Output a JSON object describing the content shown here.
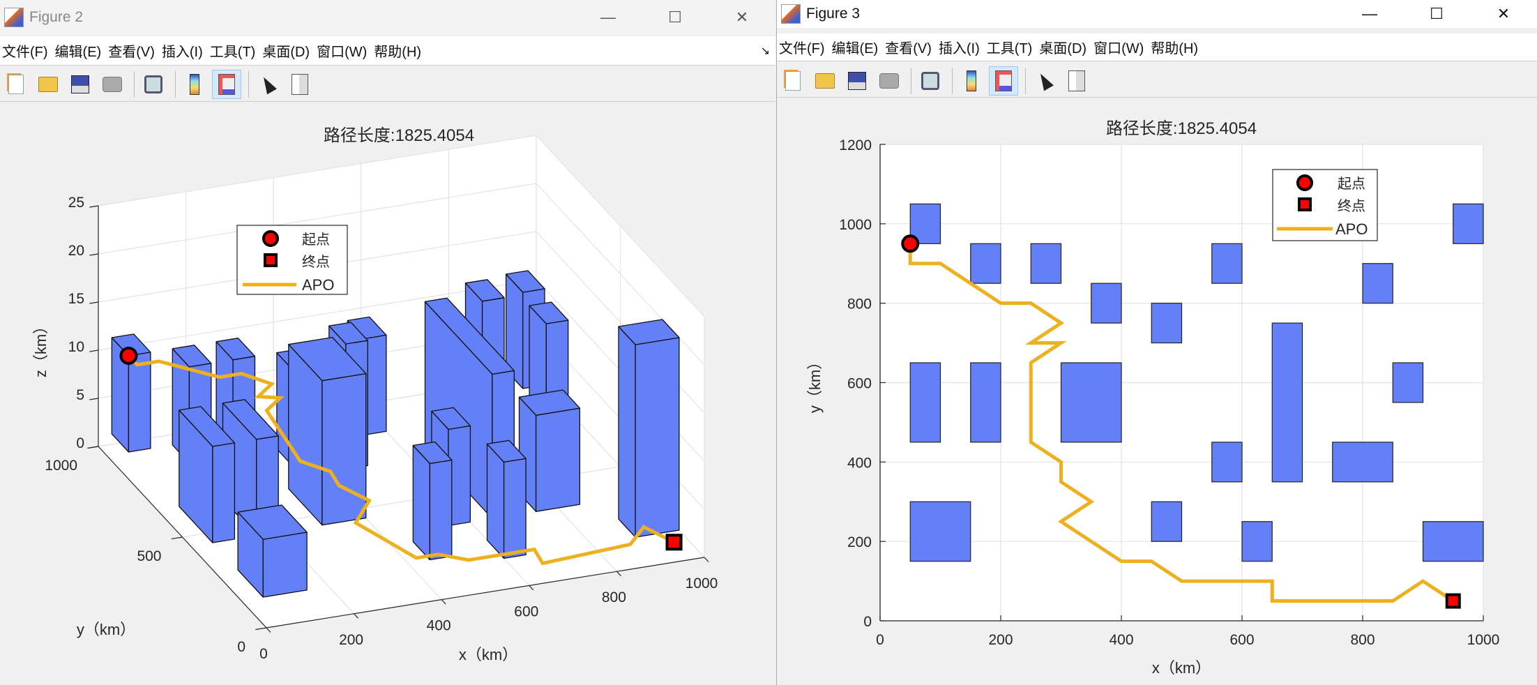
{
  "windows": [
    {
      "title": "Figure 2",
      "controls": {
        "minimize": "—",
        "maximize": "☐",
        "close": "✕"
      }
    },
    {
      "title": "Figure 3",
      "controls": {
        "minimize": "—",
        "maximize": "☐",
        "close": "✕"
      }
    }
  ],
  "menu": [
    "文件(F)",
    "编辑(E)",
    "查看(V)",
    "插入(I)",
    "工具(T)",
    "桌面(D)",
    "窗口(W)",
    "帮助(H)"
  ],
  "dock_icon": "↘",
  "toolbar": [
    "new-figure-icon",
    "open-icon",
    "save-icon",
    "print-icon",
    "link-plot-icon",
    "colorbar-icon",
    "legend-icon",
    "pointer-icon",
    "property-inspector-icon"
  ],
  "colors": {
    "obstacle": "#6480f6",
    "path": "#edb120",
    "marker": "#ff0000",
    "grid": "#e3e3e3"
  },
  "chart_data": [
    {
      "type": "3d-bar-scene",
      "title": "路径长度:1825.4054",
      "xlabel": "x（km）",
      "ylabel": "y（km）",
      "zlabel": "z（km）",
      "xlim": [
        0,
        1000
      ],
      "ylim": [
        0,
        1000
      ],
      "zlim": [
        0,
        25
      ],
      "xticks": [
        0,
        200,
        400,
        600,
        800,
        1000
      ],
      "yticks": [
        0,
        500,
        1000
      ],
      "zticks": [
        0,
        5,
        10,
        15,
        20,
        25
      ],
      "grid": true,
      "legend": {
        "position": "top-left",
        "entries": [
          "起点",
          "终点",
          "APO"
        ]
      },
      "obstacles": [
        {
          "x": [
            50,
            100
          ],
          "y": [
            950,
            1050
          ],
          "h": 10
        },
        {
          "x": [
            150,
            200
          ],
          "y": [
            850,
            950
          ],
          "h": 10
        },
        {
          "x": [
            250,
            300
          ],
          "y": [
            850,
            950
          ],
          "h": 10
        },
        {
          "x": [
            350,
            400
          ],
          "y": [
            750,
            850
          ],
          "h": 10
        },
        {
          "x": [
            450,
            500
          ],
          "y": [
            700,
            800
          ],
          "h": 13
        },
        {
          "x": [
            550,
            600
          ],
          "y": [
            850,
            950
          ],
          "h": 10
        },
        {
          "x": [
            800,
            850
          ],
          "y": [
            800,
            900
          ],
          "h": 13
        },
        {
          "x": [
            950,
            1000
          ],
          "y": [
            950,
            1050
          ],
          "h": 10
        },
        {
          "x": [
            50,
            100
          ],
          "y": [
            450,
            650
          ],
          "h": 10
        },
        {
          "x": [
            150,
            200
          ],
          "y": [
            450,
            650
          ],
          "h": 10
        },
        {
          "x": [
            300,
            400
          ],
          "y": [
            450,
            650
          ],
          "h": 15
        },
        {
          "x": [
            650,
            700
          ],
          "y": [
            350,
            750
          ],
          "h": 15
        },
        {
          "x": [
            850,
            900
          ],
          "y": [
            550,
            650
          ],
          "h": 15
        },
        {
          "x": [
            550,
            600
          ],
          "y": [
            350,
            450
          ],
          "h": 10
        },
        {
          "x": [
            750,
            850
          ],
          "y": [
            350,
            450
          ],
          "h": 10
        },
        {
          "x": [
            50,
            150
          ],
          "y": [
            150,
            300
          ],
          "h": 6
        },
        {
          "x": [
            450,
            500
          ],
          "y": [
            200,
            300
          ],
          "h": 10
        },
        {
          "x": [
            600,
            650
          ],
          "y": [
            150,
            250
          ],
          "h": 10
        },
        {
          "x": [
            900,
            1000
          ],
          "y": [
            150,
            250
          ],
          "h": 20
        }
      ],
      "path": {
        "x": [
          50,
          50,
          100,
          200,
          250,
          300,
          250,
          300,
          250,
          250,
          300,
          300,
          350,
          300,
          400,
          450,
          500,
          650,
          650,
          850,
          900,
          950
        ],
        "y": [
          950,
          900,
          900,
          800,
          800,
          750,
          700,
          700,
          650,
          450,
          400,
          350,
          300,
          250,
          150,
          150,
          100,
          100,
          50,
          50,
          100,
          50
        ],
        "z": [
          10,
          10,
          10,
          9.5,
          9.5,
          9,
          9,
          8.5,
          8.5,
          7,
          6.5,
          6,
          5,
          4,
          1.5,
          1.5,
          1.5,
          1.5,
          1,
          1.5,
          2,
          1
        ]
      },
      "start": [
        50,
        950,
        10
      ],
      "goal": [
        950,
        50,
        1
      ]
    },
    {
      "type": "2d-map",
      "title": "路径长度:1825.4054",
      "xlabel": "x（km）",
      "ylabel": "y（km）",
      "xlim": [
        0,
        1000
      ],
      "ylim": [
        0,
        1200
      ],
      "xticks": [
        0,
        200,
        400,
        600,
        800,
        1000
      ],
      "yticks": [
        0,
        200,
        400,
        600,
        800,
        1000,
        1200
      ],
      "grid": true,
      "legend": {
        "position": "top-right",
        "entries": [
          "起点",
          "终点",
          "APO"
        ]
      },
      "start": [
        50,
        950
      ],
      "goal": [
        950,
        50
      ]
    }
  ]
}
